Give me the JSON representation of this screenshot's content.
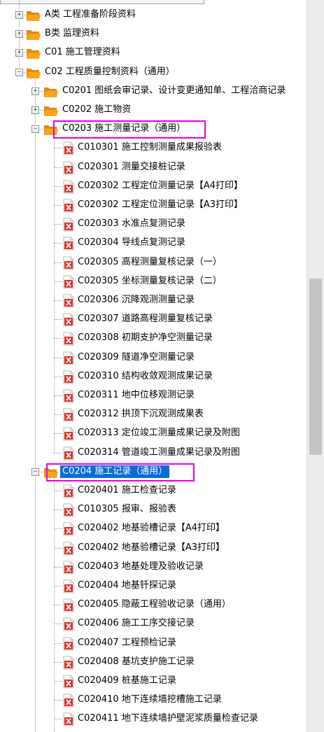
{
  "tree": {
    "nodes": [
      {
        "label": "A类 工程准备阶段资料",
        "level": 0,
        "kind": "folder",
        "toggle": "+"
      },
      {
        "label": "B类 监理资料",
        "level": 0,
        "kind": "folder",
        "toggle": "+"
      },
      {
        "label": "C01 施工管理资料",
        "level": 0,
        "kind": "folder",
        "toggle": "+"
      },
      {
        "label": "C02 工程质量控制资料（通用）",
        "level": 0,
        "kind": "folder",
        "toggle": "-"
      },
      {
        "label": "C0201 图纸会审记录、设计变更通知单、工程洽商记录",
        "level": 1,
        "kind": "folder",
        "toggle": "+"
      },
      {
        "label": "C0202 施工物资",
        "level": 1,
        "kind": "folder",
        "toggle": "+"
      },
      {
        "label": "C0203 施工测量记录（通用）",
        "level": 1,
        "kind": "folder",
        "toggle": "-",
        "highlight": true
      },
      {
        "label": "C010301 施工控制测量成果报验表",
        "level": 2,
        "kind": "doc"
      },
      {
        "label": "C020301 测量交接桩记录",
        "level": 2,
        "kind": "doc"
      },
      {
        "label": "C020302 工程定位测量记录【A4打印】",
        "level": 2,
        "kind": "doc"
      },
      {
        "label": "C020302 工程定位测量记录【A3打印】",
        "level": 2,
        "kind": "doc"
      },
      {
        "label": "C020303 水准点复测记录",
        "level": 2,
        "kind": "doc"
      },
      {
        "label": "C020304 导线点复测记录",
        "level": 2,
        "kind": "doc"
      },
      {
        "label": "C020305 高程测量复核记录（一）",
        "level": 2,
        "kind": "doc"
      },
      {
        "label": "C020305 坐标测量复核记录（二）",
        "level": 2,
        "kind": "doc"
      },
      {
        "label": "C020306 沉降观测测量记录",
        "level": 2,
        "kind": "doc"
      },
      {
        "label": "C020307 道路高程测量复核记录",
        "level": 2,
        "kind": "doc"
      },
      {
        "label": "C020308 初期支护净空测量记录",
        "level": 2,
        "kind": "doc"
      },
      {
        "label": "C020309 隧道净空测量记录",
        "level": 2,
        "kind": "doc"
      },
      {
        "label": "C020310 结构收敛观测成果记录",
        "level": 2,
        "kind": "doc"
      },
      {
        "label": "C020311 地中位移观测记录",
        "level": 2,
        "kind": "doc"
      },
      {
        "label": "C020312 拱顶下沉观测成果表",
        "level": 2,
        "kind": "doc"
      },
      {
        "label": "C020313 定位竣工测量成果记录及附图",
        "level": 2,
        "kind": "doc"
      },
      {
        "label": "C020314 管道竣工测量成果记录及附图",
        "level": 2,
        "kind": "doc"
      },
      {
        "label": "C0204 施工记录（通用）",
        "level": 1,
        "kind": "folder",
        "toggle": "-",
        "selected": true,
        "highlight": true
      },
      {
        "label": "C020401 施工检查记录",
        "level": 2,
        "kind": "doc"
      },
      {
        "label": "C010305 报审、报验表",
        "level": 2,
        "kind": "doc"
      },
      {
        "label": "C020402 地基验槽记录【A4打印】",
        "level": 2,
        "kind": "doc"
      },
      {
        "label": "C020402 地基验槽记录【A3打印】",
        "level": 2,
        "kind": "doc"
      },
      {
        "label": "C020403 地基处理及验收记录",
        "level": 2,
        "kind": "doc"
      },
      {
        "label": "C020404 地基钎探记录",
        "level": 2,
        "kind": "doc"
      },
      {
        "label": "C020405 隐蔽工程验收记录（通用）",
        "level": 2,
        "kind": "doc"
      },
      {
        "label": "C020406 施工工序交接记录",
        "level": 2,
        "kind": "doc"
      },
      {
        "label": "C020407 工程预检记录",
        "level": 2,
        "kind": "doc"
      },
      {
        "label": "C020408 基坑支护施工记录",
        "level": 2,
        "kind": "doc"
      },
      {
        "label": "C020409 桩基施工记录",
        "level": 2,
        "kind": "doc"
      },
      {
        "label": "C020410 地下连续墙挖槽施工记录",
        "level": 2,
        "kind": "doc"
      },
      {
        "label": "C020411 地下连续墙护壁泥浆质量检查记录",
        "level": 2,
        "kind": "doc"
      }
    ]
  },
  "icons": {
    "folder": "folder-open-icon",
    "doc": "pdf-document-icon",
    "expand": "plus-box-icon",
    "collapse": "minus-box-icon"
  },
  "colors": {
    "folder": "#f7a51c",
    "doc_red": "#e0322c",
    "selection": "#0a6cd6",
    "highlight": "#e400e4"
  }
}
